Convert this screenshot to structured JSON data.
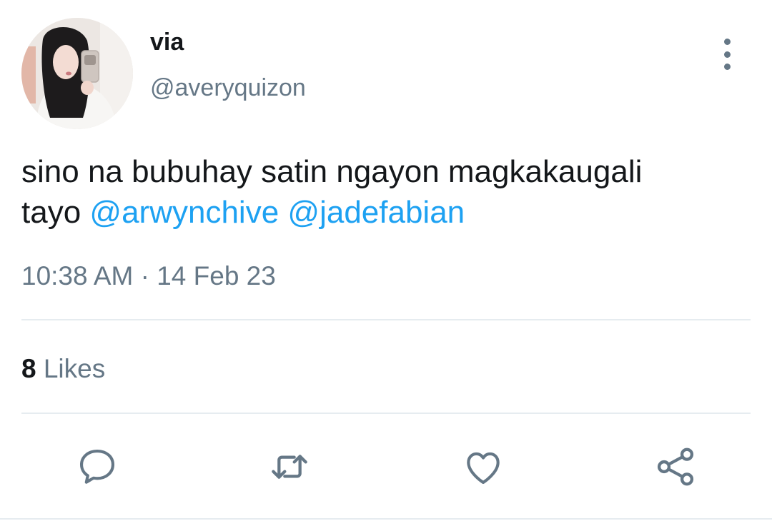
{
  "author": {
    "display_name": "via",
    "handle": "@averyquizon"
  },
  "tweet": {
    "text_line1": "sino na bubuhay satin ngayon magkakaugali",
    "text_line2_prefix": "tayo",
    "mentions": [
      "@arwynchive",
      "@jadefabian"
    ],
    "timestamp": "10:38 AM · 14 Feb 23"
  },
  "stats": {
    "likes_count": "8",
    "likes_label": "Likes"
  },
  "icons": {
    "more": "more-vertical-icon",
    "reply": "comment-icon",
    "retweet": "retweet-icon",
    "like": "heart-icon",
    "share": "share-icon"
  },
  "colors": {
    "text": "#14171a",
    "secondary": "#657786",
    "link": "#1da1f2",
    "divider": "#e6ecf0"
  }
}
